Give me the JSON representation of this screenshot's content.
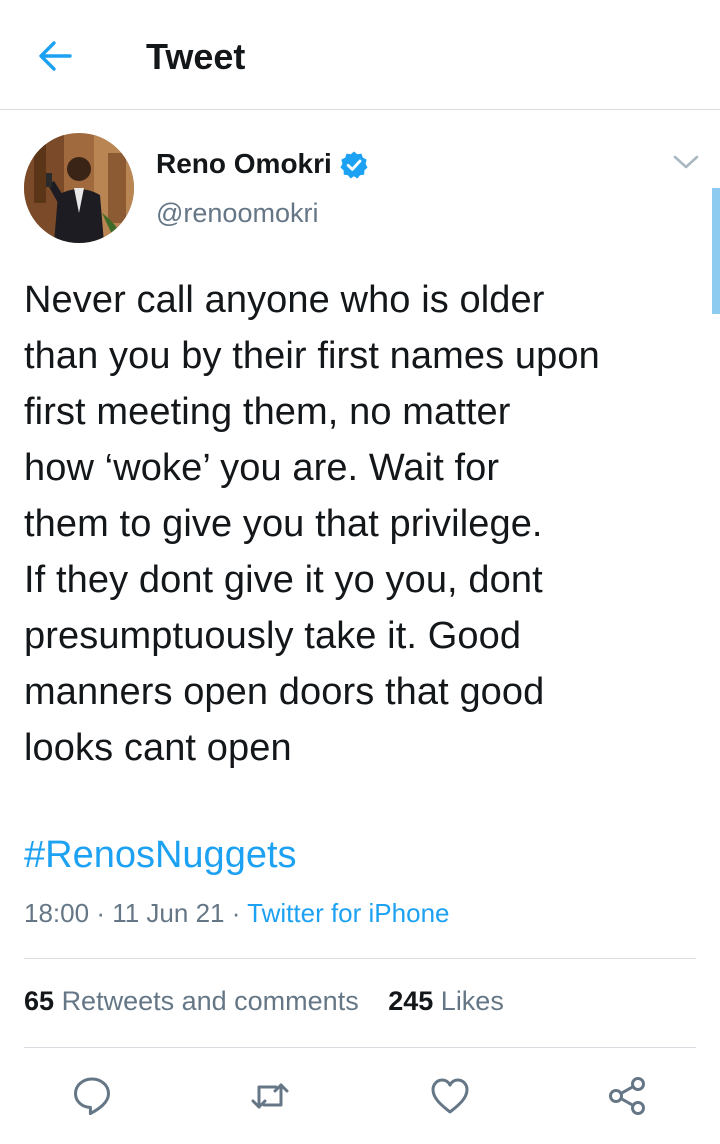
{
  "header": {
    "title": "Tweet"
  },
  "tweet": {
    "author_name": "Reno Omokri",
    "author_handle": "@renoomokri",
    "text_lines": [
      "Never call anyone who is older",
      "than you by their first names upon",
      "first meeting them, no matter",
      "how ‘woke’ you are. Wait for",
      "them to give you that privilege.",
      "If they dont give it yo you, dont",
      "presumptuously take it. Good",
      "manners open doors that good",
      "looks cant open"
    ],
    "hashtag": "#RenosNuggets",
    "time": "18:00",
    "date": "11 Jun 21",
    "separator": "·",
    "source": "Twitter for iPhone"
  },
  "stats": {
    "retweets_count": "65",
    "retweets_label": "Retweets and comments",
    "likes_count": "245",
    "likes_label": "Likes"
  },
  "icons": {
    "back": "arrow-left-icon",
    "verified": "verified-badge-icon",
    "caret": "chevron-down-icon",
    "reply": "reply-icon",
    "retweet": "retweet-icon",
    "like": "heart-icon",
    "share": "share-icon"
  },
  "colors": {
    "accent": "#1da1f2",
    "text": "#14171a",
    "secondary": "#657786",
    "divider": "#d9dde1"
  }
}
